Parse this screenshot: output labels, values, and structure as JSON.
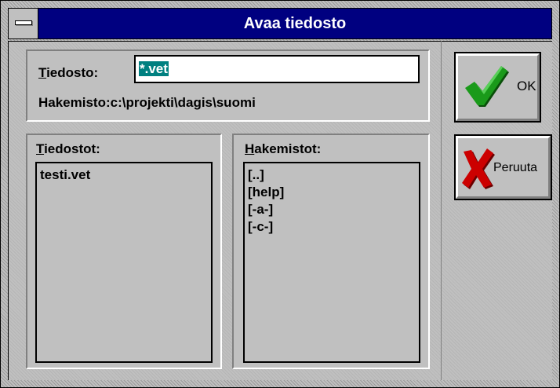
{
  "dialog": {
    "title": "Avaa tiedosto",
    "file_label_accel": "T",
    "file_label_rest": "iedosto:",
    "file_value": "*.vet",
    "dir_label": "Hakemisto:",
    "dir_path": "c:\\projekti\\dagis\\suomi"
  },
  "files": {
    "title_accel": "T",
    "title_rest": "iedostot:",
    "items": [
      "testi.vet"
    ]
  },
  "dirs": {
    "title_accel": "H",
    "title_rest": "akemistot:",
    "items": [
      "[..]",
      "[help]",
      "[-a-]",
      "[-c-]"
    ]
  },
  "buttons": {
    "ok_label": "OK",
    "cancel_label": "Peruuta"
  },
  "icons": {
    "system_menu": "minus-bar-icon",
    "ok": "checkmark-icon",
    "cancel": "red-x-icon"
  },
  "colors": {
    "title_bar": "#000080",
    "selection": "#008080",
    "checkmark": "#1a9a1a",
    "cross": "#cc0000"
  }
}
